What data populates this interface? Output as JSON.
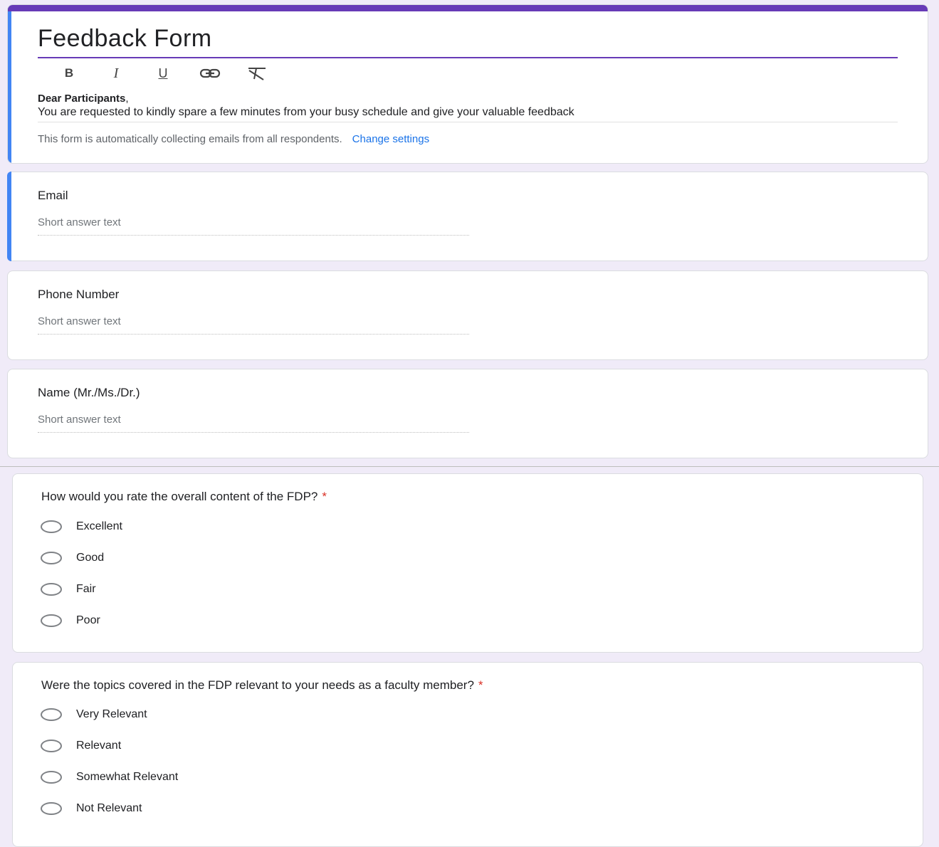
{
  "header": {
    "title": "Feedback Form",
    "toolbar": {
      "bold": "B",
      "italic": "I",
      "underline": "U"
    },
    "greeting": "Dear Participants",
    "greeting_comma": ",",
    "description": "You are requested to kindly spare a few minutes from your busy schedule and give your valuable feedback",
    "collect_note": "This form is automatically collecting emails from all respondents.",
    "change_settings": "Change settings"
  },
  "short_answer_questions": [
    {
      "label": "Email",
      "placeholder": "Short answer text"
    },
    {
      "label": "Phone Number",
      "placeholder": "Short answer text"
    },
    {
      "label": "Name (Mr./Ms./Dr.)",
      "placeholder": "Short answer text"
    }
  ],
  "multiple_choice_questions": [
    {
      "label": "How would you rate the overall content of the FDP?",
      "required_mark": "*",
      "options": [
        "Excellent",
        "Good",
        "Fair",
        "Poor"
      ]
    },
    {
      "label": "Were the topics covered in the FDP relevant to your needs as a faculty member?",
      "required_mark": "*",
      "options": [
        "Very Relevant",
        "Relevant",
        "Somewhat Relevant",
        "Not Relevant"
      ]
    }
  ],
  "colors": {
    "theme": "#673ab7",
    "active_indicator": "#4285f4",
    "link": "#1a73e8",
    "required": "#d93025",
    "background": "#f0ebf8"
  }
}
